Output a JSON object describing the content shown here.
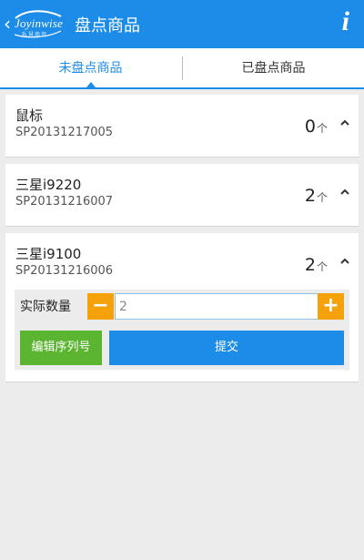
{
  "header": {
    "back_glyph": "‹",
    "logo_text": "Joyinwise",
    "logo_sub": "私慧商贸",
    "title": "盘点商品",
    "info_glyph": "i"
  },
  "tabs": [
    {
      "label": "未盘点商品",
      "active": true
    },
    {
      "label": "已盘点商品",
      "active": false
    }
  ],
  "items": [
    {
      "name": "鼠标",
      "code": "SP20131217005",
      "qty": "0",
      "unit": "个"
    },
    {
      "name": "三星i9220",
      "code": "SP20131216007",
      "qty": "2",
      "unit": "个"
    },
    {
      "name": "三星i9100",
      "code": "SP20131216006",
      "qty": "2",
      "unit": "个"
    }
  ],
  "edit": {
    "label": "实际数量",
    "minus": "−",
    "plus": "+",
    "value": "2",
    "serial_button": "编辑序列号",
    "submit_button": "提交"
  },
  "colors": {
    "primary": "#1d8ce8",
    "orange": "#f5a20a",
    "green": "#5cb531"
  }
}
